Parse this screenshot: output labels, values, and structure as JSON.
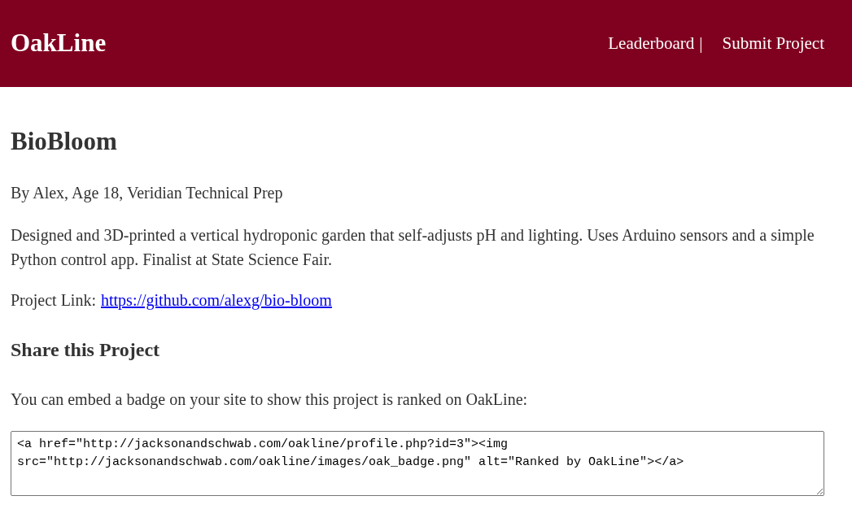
{
  "header": {
    "logo": "OakLine",
    "nav": [
      {
        "label": "Leaderboard"
      },
      {
        "label": "Submit Project"
      }
    ],
    "separator": "|"
  },
  "project": {
    "title": "BioBloom",
    "byline": "By Alex, Age 18, Veridian Technical Prep",
    "description": "Designed and 3D-printed a vertical hydroponic garden that self-adjusts pH and lighting. Uses Arduino sensors and a simple Python control app. Finalist at State Science Fair.",
    "link_label": "Project Link:",
    "link": "https://github.com/alexg/bio-bloom"
  },
  "share": {
    "heading": "Share this Project",
    "text": "You can embed a badge on your site to show this project is ranked on OakLine:",
    "embed_code": "<a href=\"http://jacksonandschwab.com/oakline/profile.php?id=3\"><img src=\"http://jacksonandschwab.com/oakline/images/oak_badge.png\" alt=\"Ranked by OakLine\"></a>"
  }
}
